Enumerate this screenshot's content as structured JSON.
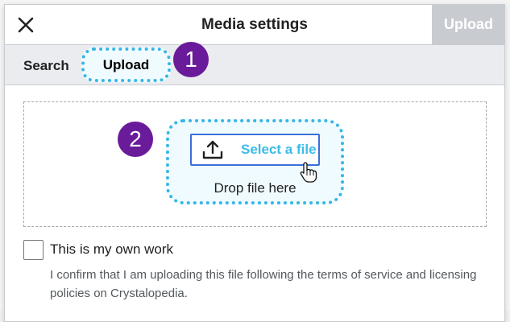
{
  "dialog": {
    "title": "Media settings",
    "primary_action": "Upload"
  },
  "tabs": [
    {
      "label": "Search",
      "selected": false
    },
    {
      "label": "Upload",
      "selected": true
    }
  ],
  "callouts": {
    "step1": "1",
    "step2": "2",
    "color": "#6a1b9a",
    "highlight_color": "#36b5e5"
  },
  "upload": {
    "select_label": "Select a file",
    "drop_text": "Drop file here"
  },
  "own_work": {
    "checked": false,
    "label": "This is my own work",
    "help": "I confirm that I am uploading this file following the terms of service and licensing policies on Crystalopedia."
  },
  "icons": {
    "close": "close-icon",
    "upload": "upload-icon",
    "pointer": "hand-pointer-icon"
  }
}
